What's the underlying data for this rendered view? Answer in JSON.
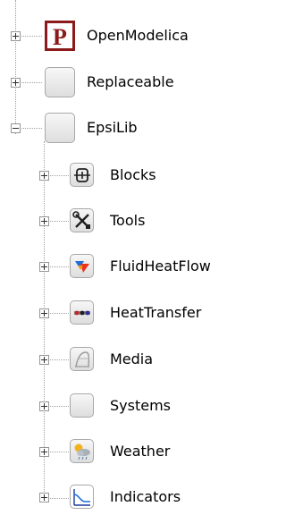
{
  "tree": {
    "items": [
      {
        "label": "OpenModelica",
        "icon": "openmodelica-logo-icon",
        "expanded": false,
        "brand_color": "#8b1a1a"
      },
      {
        "label": "Replaceable",
        "icon": "blank-package-icon",
        "expanded": false
      },
      {
        "label": "EpsiLib",
        "icon": "blank-package-icon",
        "expanded": true
      },
      {
        "label": "Blocks",
        "icon": "blocks-icon",
        "expanded": false
      },
      {
        "label": "Tools",
        "icon": "tools-icon",
        "expanded": false
      },
      {
        "label": "FluidHeatFlow",
        "icon": "fluid-heat-flow-icon",
        "expanded": false
      },
      {
        "label": "HeatTransfer",
        "icon": "heat-transfer-icon",
        "expanded": false
      },
      {
        "label": "Media",
        "icon": "media-icon",
        "expanded": false
      },
      {
        "label": "Systems",
        "icon": "blank-package-icon",
        "expanded": false
      },
      {
        "label": "Weather",
        "icon": "weather-icon",
        "expanded": false
      },
      {
        "label": "Indicators",
        "icon": "indicators-icon",
        "expanded": false
      }
    ]
  }
}
